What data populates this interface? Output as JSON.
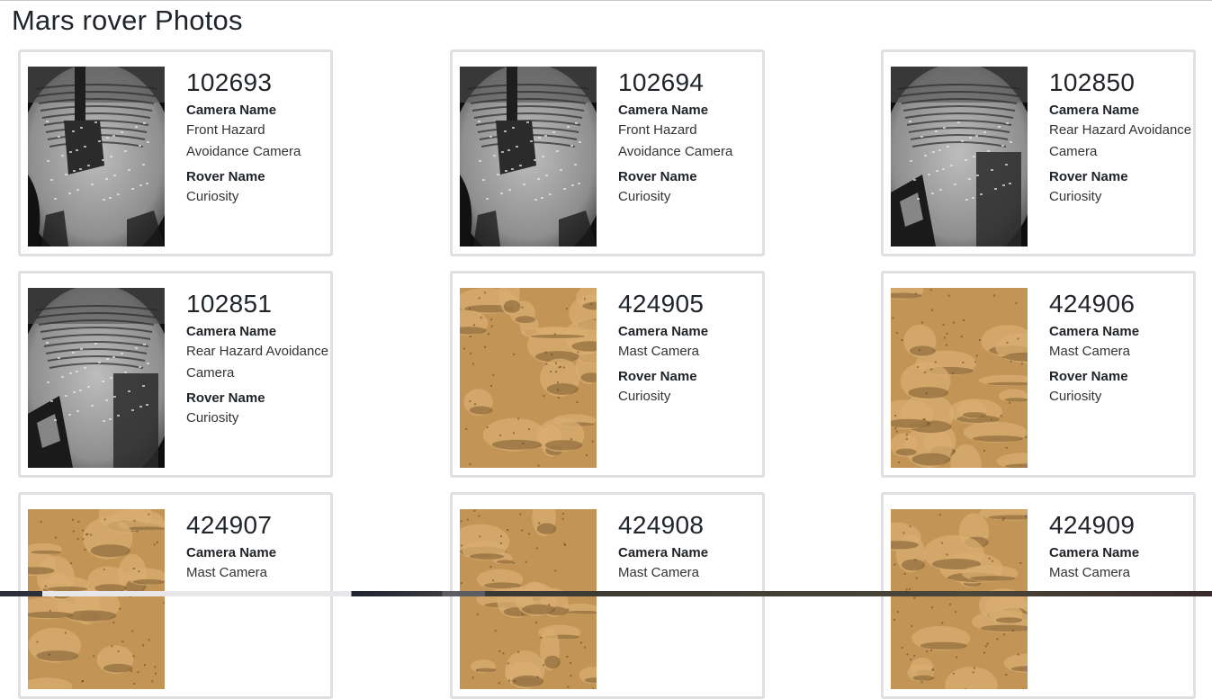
{
  "page": {
    "title": "Mars rover Photos"
  },
  "labels": {
    "camera_name": "Camera Name",
    "rover_name": "Rover Name"
  },
  "photos": [
    {
      "id": "102693",
      "camera": "Front Hazard Avoidance Camera",
      "rover": "Curiosity",
      "image": "hazcam-front-grayscale"
    },
    {
      "id": "102694",
      "camera": "Front Hazard Avoidance Camera",
      "rover": "Curiosity",
      "image": "hazcam-front-grayscale"
    },
    {
      "id": "102850",
      "camera": "Rear Hazard Avoidance Camera",
      "rover": "Curiosity",
      "image": "hazcam-rear-grayscale"
    },
    {
      "id": "102851",
      "camera": "Rear Hazard Avoidance Camera",
      "rover": "Curiosity",
      "image": "hazcam-rear-grayscale"
    },
    {
      "id": "424905",
      "camera": "Mast Camera",
      "rover": "Curiosity",
      "image": "mastcam-terrain"
    },
    {
      "id": "424906",
      "camera": "Mast Camera",
      "rover": "Curiosity",
      "image": "mastcam-terrain"
    },
    {
      "id": "424907",
      "camera": "Mast Camera",
      "rover": "",
      "image": "mastcam-terrain"
    },
    {
      "id": "424908",
      "camera": "Mast Camera",
      "rover": "",
      "image": "mastcam-terrain"
    },
    {
      "id": "424909",
      "camera": "Mast Camera",
      "rover": "",
      "image": "mastcam-terrain"
    }
  ]
}
